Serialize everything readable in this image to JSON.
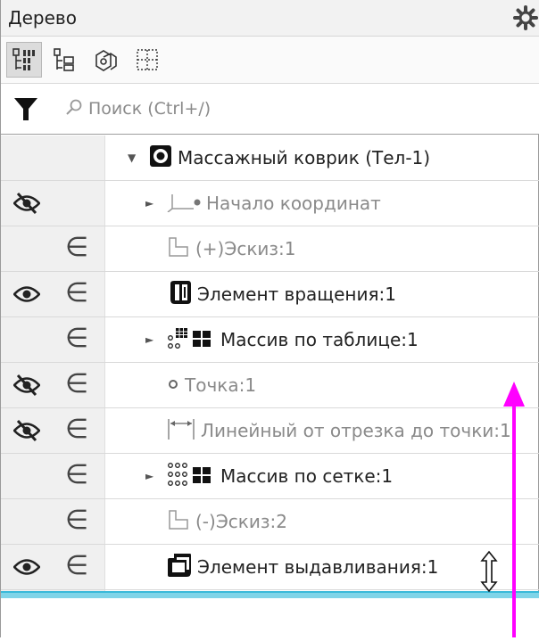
{
  "panel": {
    "title": "Дерево"
  },
  "toolbar": {
    "buttons": [
      {
        "name": "tree-by-structure",
        "active": true
      },
      {
        "name": "tree-by-operations",
        "active": false
      },
      {
        "name": "tree-by-parts",
        "active": false
      },
      {
        "name": "tree-by-selection",
        "active": false
      }
    ]
  },
  "search": {
    "placeholder": "Поиск (Ctrl+/)"
  },
  "tree": {
    "rows": [
      {
        "label": "Массажный коврик (Тел-1)",
        "visibility": "none",
        "included": false,
        "expander": "expanded",
        "icon": "body-icon",
        "dim": false,
        "indent": 1
      },
      {
        "label": "Начало координат",
        "visibility": "hidden",
        "included": false,
        "expander": "collapsed",
        "icon": "origin-icon",
        "dim": true,
        "indent": 2
      },
      {
        "label": "(+)Эскиз:1",
        "visibility": "none",
        "included": true,
        "expander": "none",
        "icon": "sketch-icon",
        "dim": true,
        "indent": 2
      },
      {
        "label": "Элемент вращения:1",
        "visibility": "visible",
        "included": true,
        "expander": "none",
        "icon": "revolve-icon",
        "dim": false,
        "indent": 2
      },
      {
        "label": "Массив по таблице:1",
        "visibility": "none",
        "included": true,
        "expander": "collapsed",
        "icon": "table-array-icon",
        "dim": false,
        "indent": 2
      },
      {
        "label": "Точка:1",
        "visibility": "hidden",
        "included": true,
        "expander": "none",
        "icon": "point-icon",
        "dim": true,
        "indent": 2
      },
      {
        "label": "Линейный от отрезка до точки:1",
        "visibility": "hidden",
        "included": true,
        "expander": "none",
        "icon": "dimension-icon",
        "dim": true,
        "indent": 2
      },
      {
        "label": "Массив по сетке:1",
        "visibility": "none",
        "included": true,
        "expander": "collapsed",
        "icon": "grid-array-icon",
        "dim": false,
        "indent": 2
      },
      {
        "label": "(-)Эскиз:2",
        "visibility": "none",
        "included": true,
        "expander": "none",
        "icon": "sketch-icon",
        "dim": true,
        "indent": 2
      },
      {
        "label": "Элемент выдавливания:1",
        "visibility": "visible",
        "included": true,
        "expander": "none",
        "icon": "extrude-icon",
        "dim": false,
        "indent": 2
      }
    ]
  },
  "colors": {
    "accent_band": "#39b9d9",
    "annotation_arrow": "#ff00ff"
  }
}
